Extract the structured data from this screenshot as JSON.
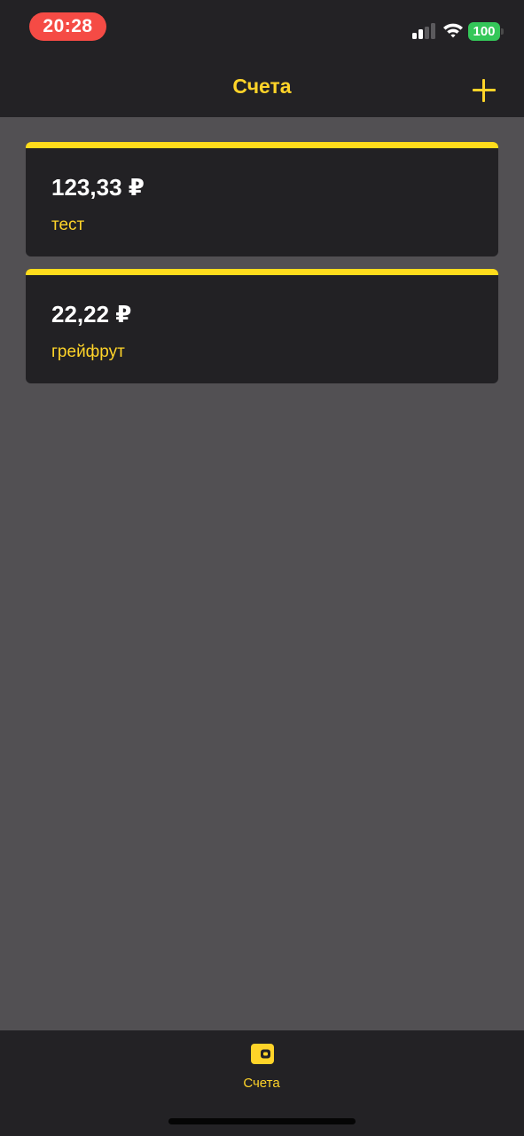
{
  "status_bar": {
    "time": "20:28",
    "battery": "100",
    "icons": [
      "signal-icon",
      "wifi-icon",
      "battery-icon"
    ],
    "time_pill_color": "#f54b45",
    "battery_color": "#34c759"
  },
  "header": {
    "title": "Счета",
    "add_icon": "plus-icon"
  },
  "accounts": [
    {
      "amount": "123,33 ₽",
      "name": "тест"
    },
    {
      "amount": "22,22 ₽",
      "name": "грейфрут"
    }
  ],
  "tabbar": {
    "items": [
      {
        "label": "Счета",
        "icon": "wallet-icon",
        "selected": true
      }
    ]
  },
  "colors": {
    "accent": "#ffd429",
    "card_stripe": "#ffdc1c",
    "card_background": "#222124",
    "page_background": "#525053",
    "bar_background": "#232225"
  }
}
